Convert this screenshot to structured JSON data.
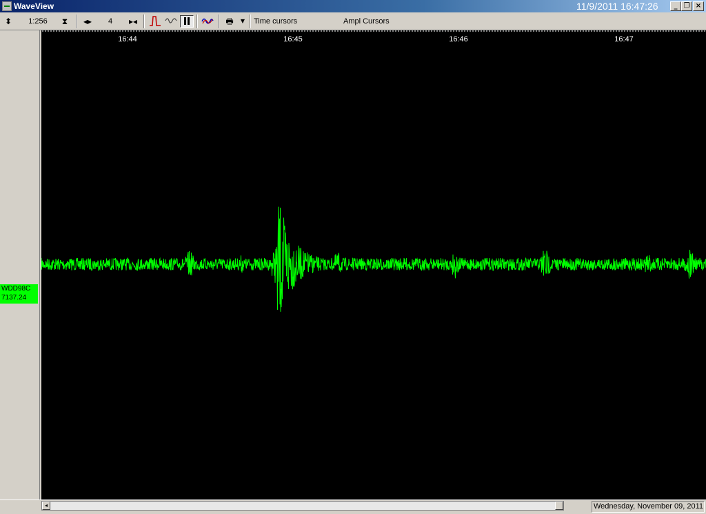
{
  "window": {
    "title": "WaveView",
    "datetime": "11/9/2011 16:47:26",
    "minimize_glyph": "_",
    "restore_glyph": "❐",
    "close_glyph": "×"
  },
  "toolbar": {
    "scale_value": "1:256",
    "time_scale_value": "4",
    "time_cursors_label": "Time cursors",
    "ampl_cursors_label": "Ampl Cursors",
    "icons": [
      "amplitude-arrows-icon",
      "zoom-vertical-icon",
      "time-arrows-icon",
      "time-compress-icon",
      "filter-icon",
      "wave-icon",
      "pause-icon",
      "spectrum-icon",
      "print-icon",
      "dropdown-icon"
    ]
  },
  "channel": {
    "label_line1": "WDD98C",
    "label_line2": "7137.24",
    "color": "#00ff00"
  },
  "timeline": {
    "ticks": [
      "16:44",
      "16:45",
      "16:46",
      "16:47"
    ]
  },
  "status": {
    "date_text": "Wednesday, November 09, 2011"
  },
  "colors": {
    "titlebar": "#0a246a",
    "trace": "#00ff00",
    "plot_background": "#000000"
  }
}
